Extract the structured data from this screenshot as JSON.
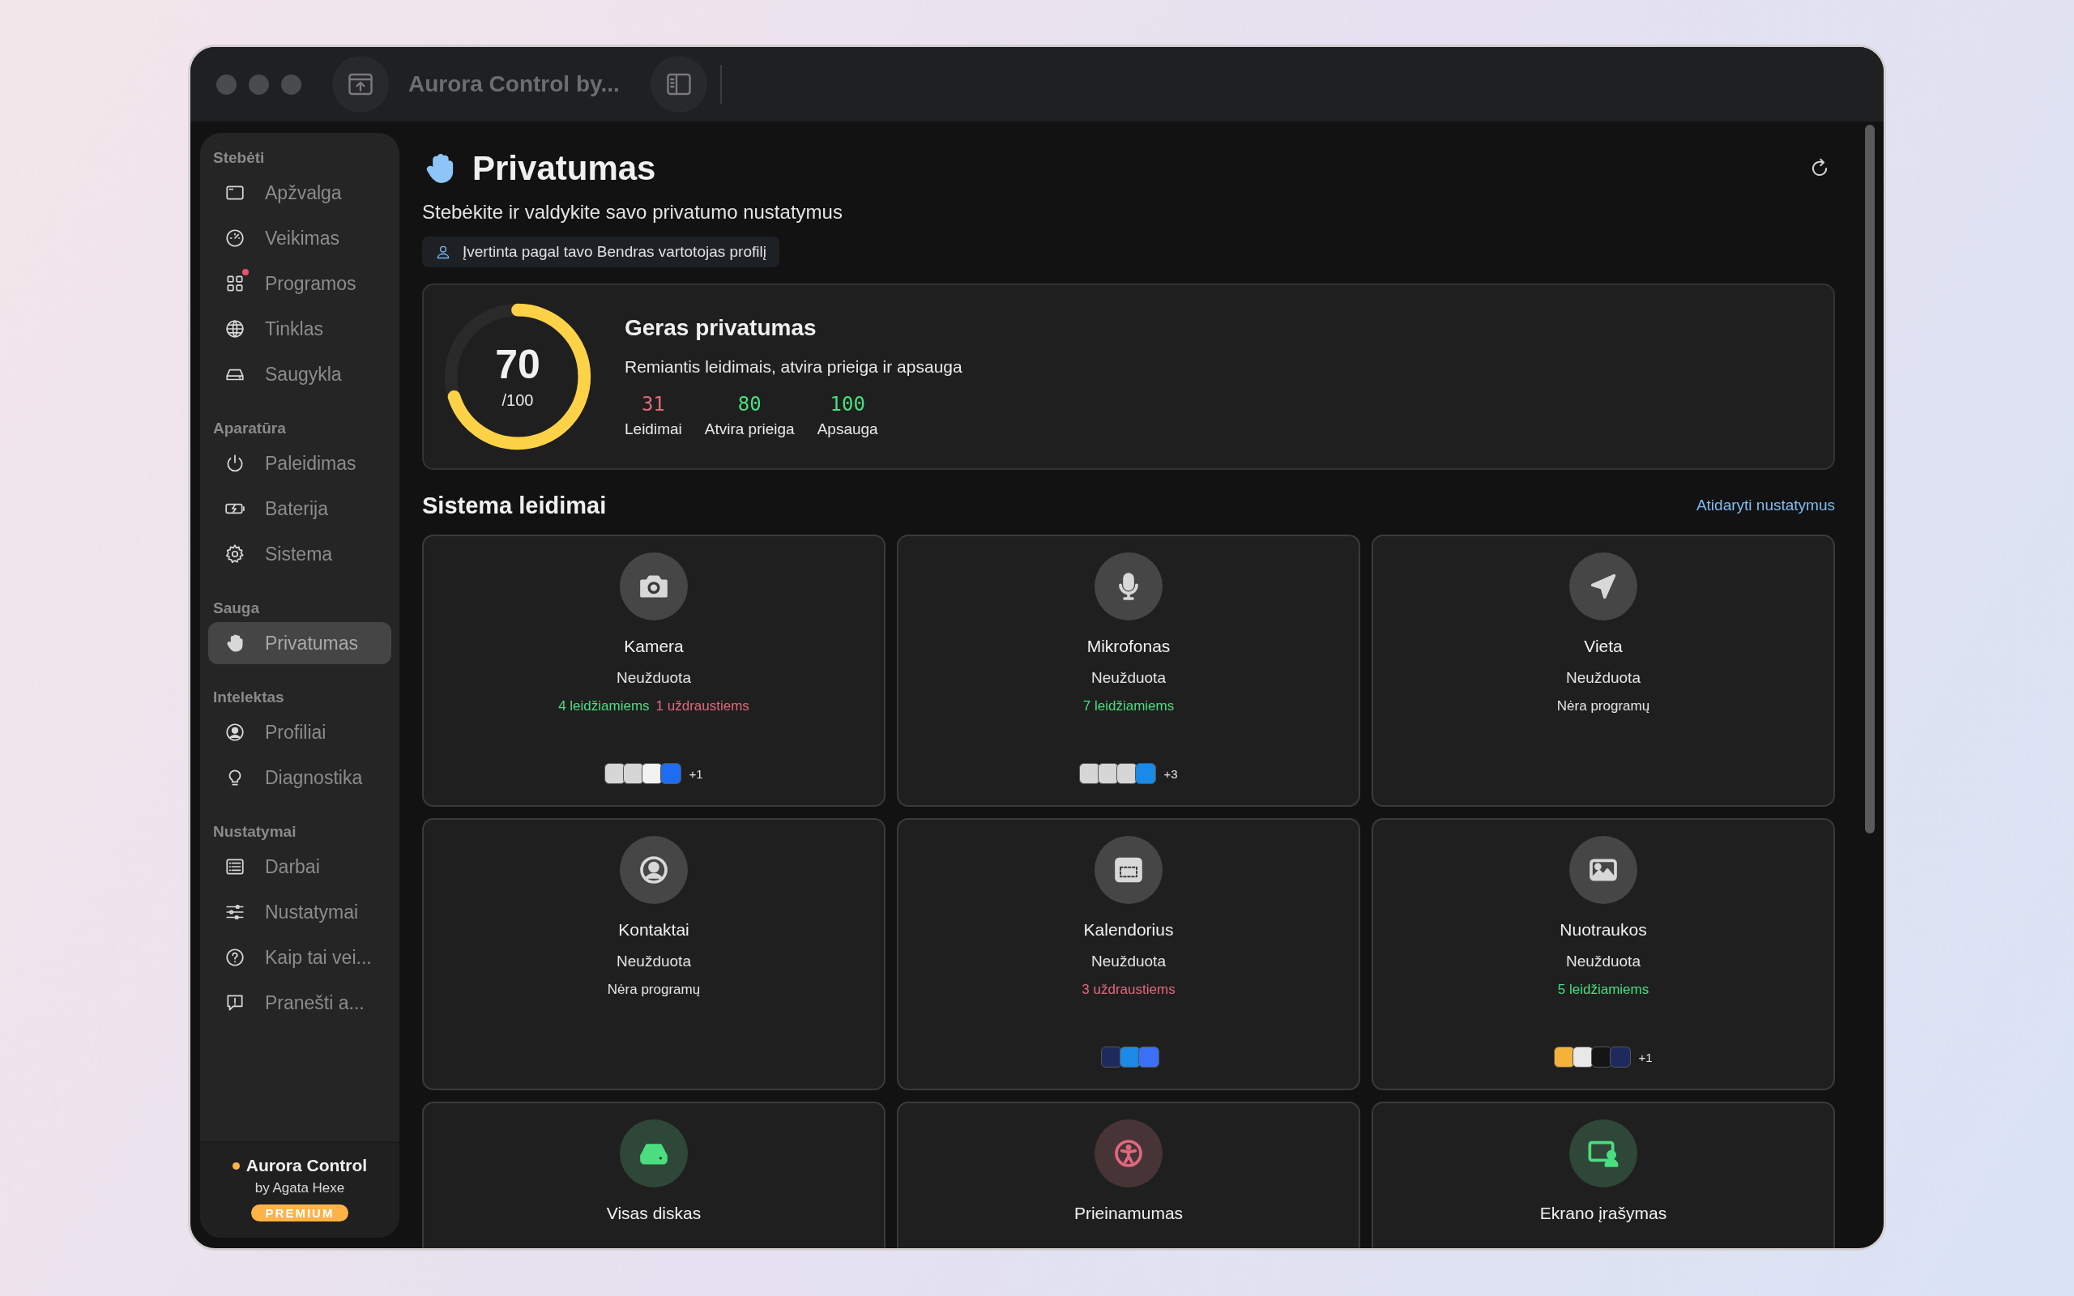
{
  "window": {
    "title": "Aurora Control by..."
  },
  "sidebar": {
    "sections": [
      {
        "label": "Stebėti",
        "items": [
          {
            "label": "Apžvalga",
            "selected": false,
            "badge": false
          },
          {
            "label": "Veikimas",
            "selected": false,
            "badge": false
          },
          {
            "label": "Programos",
            "selected": false,
            "badge": true
          },
          {
            "label": "Tinklas",
            "selected": false,
            "badge": false
          },
          {
            "label": "Saugykla",
            "selected": false,
            "badge": false
          }
        ]
      },
      {
        "label": "Aparatūra",
        "items": [
          {
            "label": "Paleidimas",
            "selected": false,
            "badge": false
          },
          {
            "label": "Baterija",
            "selected": false,
            "badge": false
          },
          {
            "label": "Sistema",
            "selected": false,
            "badge": false
          }
        ]
      },
      {
        "label": "Sauga",
        "items": [
          {
            "label": "Privatumas",
            "selected": true,
            "badge": false
          }
        ]
      },
      {
        "label": "Intelektas",
        "items": [
          {
            "label": "Profiliai",
            "selected": false,
            "badge": false
          },
          {
            "label": "Diagnostika",
            "selected": false,
            "badge": false
          }
        ]
      },
      {
        "label": "Nustatymai",
        "items": [
          {
            "label": "Darbai",
            "selected": false,
            "badge": false
          },
          {
            "label": "Nustatymai",
            "selected": false,
            "badge": false
          },
          {
            "label": "Kaip tai vei...",
            "selected": false,
            "badge": false
          },
          {
            "label": "Pranešti a...",
            "selected": false,
            "badge": false
          }
        ]
      }
    ],
    "footer": {
      "name": "Aurora Control",
      "author": "by Agata Hexe",
      "tier": "PREMIUM"
    }
  },
  "header": {
    "title": "Privatumas",
    "subtitle": "Stebėkite ir valdykite savo privatumo nustatymus",
    "profile_note": "Įvertinta pagal tavo Bendras vartotojas profilį"
  },
  "score": {
    "value": "70",
    "max": "/100",
    "level": 0.7,
    "title": "Geras privatumas",
    "description": "Remiantis leidimais, atvira prieiga ir apsauga",
    "stats": [
      {
        "value": "31",
        "label": "Leidimai",
        "color": "#e0697d"
      },
      {
        "value": "80",
        "label": "Atvira prieiga",
        "color": "#4ade80"
      },
      {
        "value": "100",
        "label": "Apsauga",
        "color": "#4ade80"
      }
    ]
  },
  "permissions": {
    "title": "Sistema leidimai",
    "link": "Atidaryti nustatymus",
    "cards": [
      {
        "color": "#d8d8d8",
        "title": "Kamera",
        "status": "Neužduota",
        "counts": [
          {
            "text": "4 leidžiamiems",
            "color": "#4ade80"
          },
          {
            "text": "1 uždraustiems",
            "color": "#e0697d"
          }
        ],
        "apps": [
          {
            "color": "#d6d6d6"
          },
          {
            "color": "#d6d6d6"
          },
          {
            "color": "#f2f2f2"
          },
          {
            "color": "#1d6cf2"
          }
        ],
        "more": "+1"
      },
      {
        "color": "#d8d8d8",
        "title": "Mikrofonas",
        "status": "Neužduota",
        "counts": [
          {
            "text": "7 leidžiamiems",
            "color": "#4ade80"
          }
        ],
        "apps": [
          {
            "color": "#d6d6d6"
          },
          {
            "color": "#d6d6d6"
          },
          {
            "color": "#d6d6d6"
          },
          {
            "color": "#1a8ae6"
          }
        ],
        "more": "+3"
      },
      {
        "color": "#d8d8d8",
        "title": "Vieta",
        "status": "Neužduota",
        "counts": [
          {
            "text": "Nėra programų",
            "color": "#e4e4e4"
          }
        ]
      },
      {
        "color": "#d8d8d8",
        "title": "Kontaktai",
        "status": "Neužduota",
        "counts": [
          {
            "text": "Nėra programų",
            "color": "#e4e4e4"
          }
        ]
      },
      {
        "color": "#d8d8d8",
        "title": "Kalendorius",
        "status": "Neužduota",
        "counts": [
          {
            "text": "3 uždraustiems",
            "color": "#e0697d"
          }
        ],
        "apps": [
          {
            "color": "#1f2a5c"
          },
          {
            "color": "#1a8ae6"
          },
          {
            "color": "#3b6ff5"
          }
        ]
      },
      {
        "color": "#d8d8d8",
        "title": "Nuotraukos",
        "status": "Neužduota",
        "counts": [
          {
            "text": "5 leidžiamiems",
            "color": "#4ade80"
          }
        ],
        "apps": [
          {
            "color": "#f5b23b"
          },
          {
            "color": "#e8e8e8"
          },
          {
            "color": "#151515"
          },
          {
            "color": "#1f2a5c"
          }
        ],
        "more": "+1"
      },
      {
        "color": "#4ade80",
        "title": "Visas diskas"
      },
      {
        "color": "#e0697d",
        "title": "Prieinamumas"
      },
      {
        "color": "#4ade80",
        "title": "Ekrano įrašymas"
      }
    ]
  }
}
